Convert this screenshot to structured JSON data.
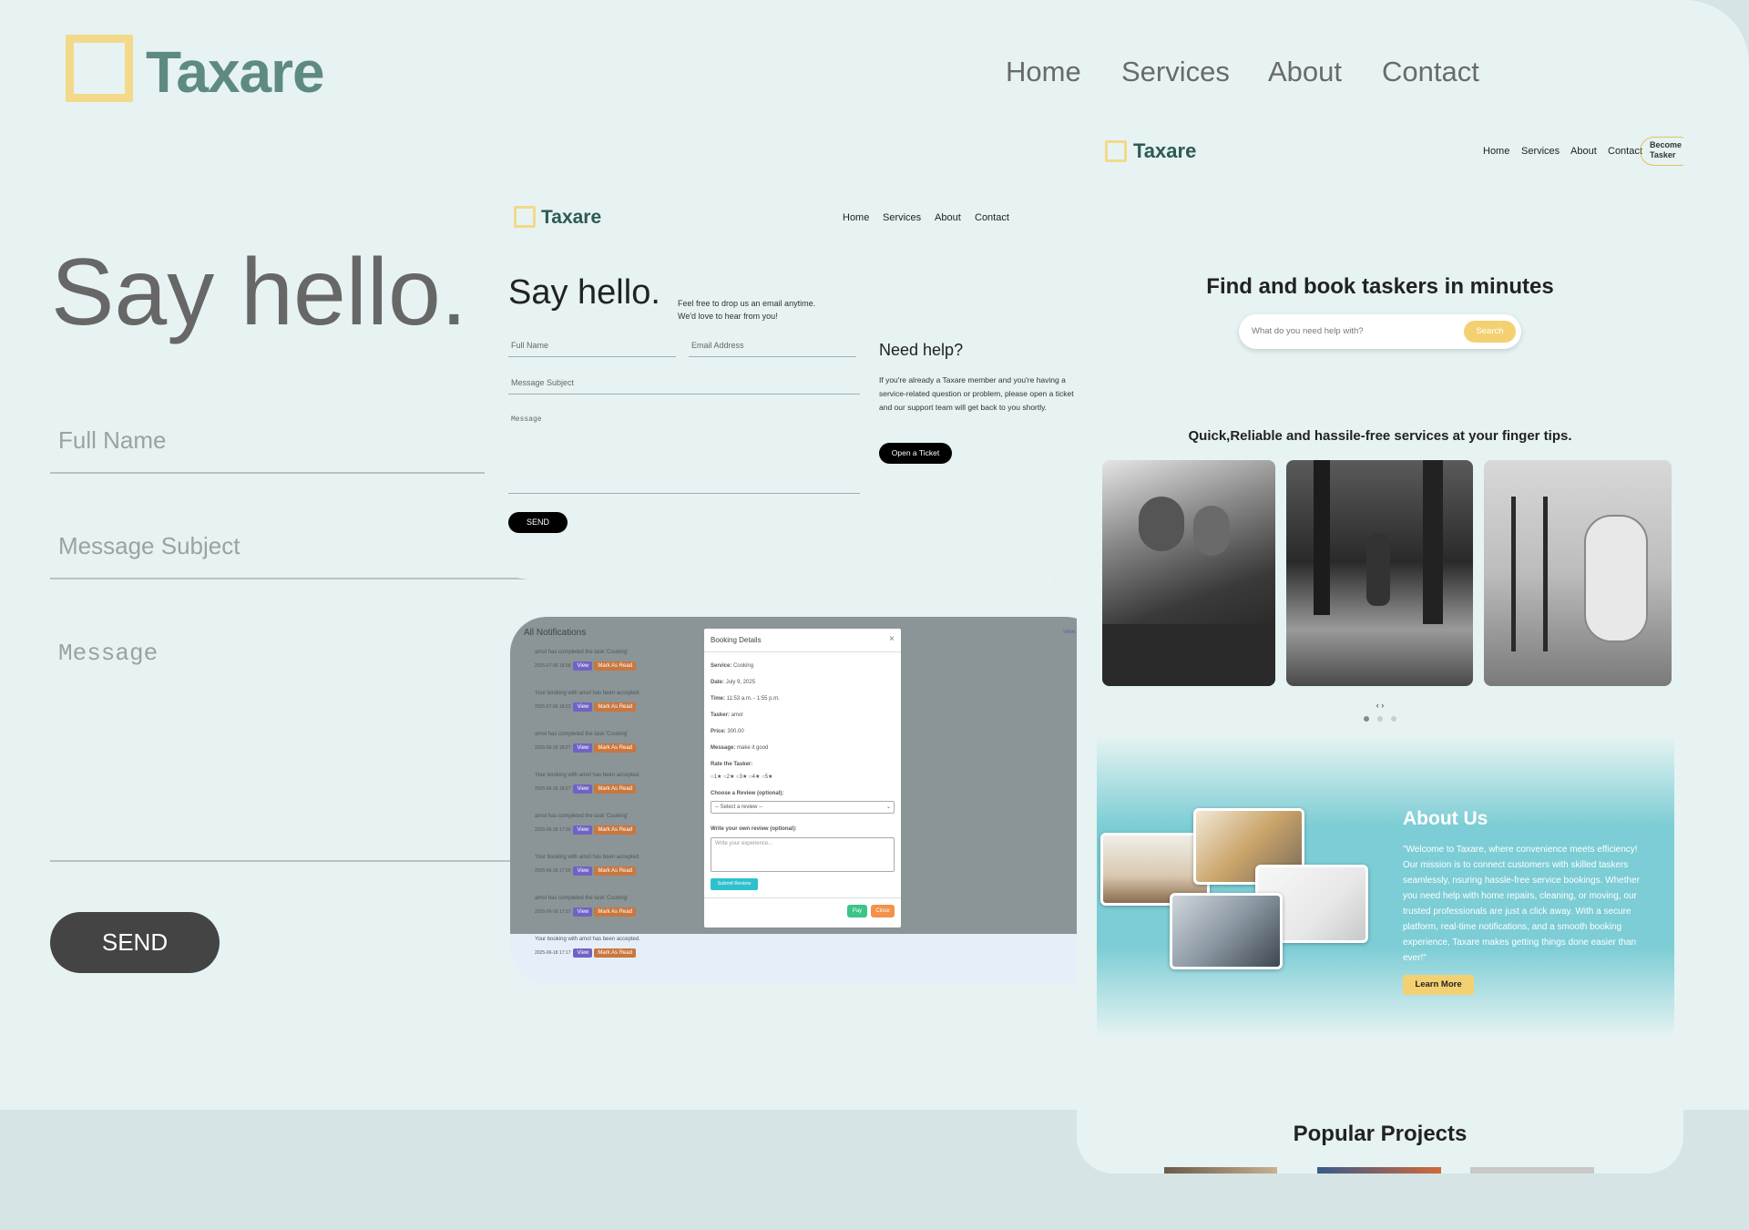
{
  "background_page": {
    "brand": "Taxare",
    "nav": [
      "Home",
      "Services",
      "About",
      "Contact"
    ],
    "heading": "Say hello.",
    "fields": {
      "full_name": "Full Name",
      "subject": "Message Subject",
      "message": "Message"
    },
    "send_label": "SEND"
  },
  "contact_mock": {
    "brand": "Taxare",
    "nav": [
      "Home",
      "Services",
      "About",
      "Contact"
    ],
    "heading": "Say hello.",
    "intro": "Feel free to drop us an email anytime. We'd love to hear from you!",
    "fields": {
      "full_name": "Full Name",
      "email": "Email Address",
      "subject": "Message Subject",
      "message": "Message"
    },
    "send_label": "SEND",
    "help_title": "Need help?",
    "help_text": "If you're already a Taxare member and you're having a service-related question or problem, please open a ticket and our support team will get back to you shortly.",
    "ticket_label": "Open a Ticket"
  },
  "notifications_mock": {
    "title": "All Notifications",
    "view_all": "View All",
    "items": [
      {
        "text": "amol has completed the task 'Cooking'",
        "time": "2025-07-06 18:38"
      },
      {
        "text": "Your booking with amol has been accepted.",
        "time": "2025-07-06 18:23"
      },
      {
        "text": "amol has completed the task 'Cooking'",
        "time": "2025-06-18 18:27"
      },
      {
        "text": "Your booking with amol has been accepted.",
        "time": "2025-06-18 18:27"
      },
      {
        "text": "amol has completed the task 'Cooking'",
        "time": "2025-06-18 17:30"
      },
      {
        "text": "Your booking with amol has been accepted.",
        "time": "2025-06-18 17:26"
      },
      {
        "text": "amol has completed the task 'Cooking'",
        "time": "2025-06-18 17:27"
      },
      {
        "text": "Your booking with amol has been accepted.",
        "time": "2025-06-18 17:17"
      }
    ],
    "view_label": "View",
    "mark_label": "Mark As Read",
    "modal": {
      "title": "Booking Details",
      "close_x": "×",
      "service_k": "Service:",
      "service_v": "Cooking",
      "date_k": "Date:",
      "date_v": "July 9, 2025",
      "time_k": "Time:",
      "time_v": "11:53 a.m. - 1:55 p.m.",
      "tasker_k": "Tasker:",
      "tasker_v": "amol",
      "price_k": "Price:",
      "price_v": "300.00",
      "message_k": "Message:",
      "message_v": "make it good",
      "rate_label": "Rate the Tasker:",
      "ratings": [
        "1★",
        "2★",
        "3★",
        "4★",
        "5★"
      ],
      "choose_label": "Choose a Review (optional):",
      "select_value": "-- Select a review --",
      "write_label": "Write your own review (optional):",
      "textarea_placeholder": "Write your experience...",
      "submit_label": "Submit Review",
      "pay_label": "Pay",
      "close_label": "Close"
    }
  },
  "home_mock": {
    "brand": "Taxare",
    "nav": [
      "Home",
      "Services",
      "About",
      "Contact"
    ],
    "become_label": "Become Tasker",
    "hero_title": "Find and book taskers in minutes",
    "search_placeholder": "What do you need help with?",
    "search_label": "Search",
    "tagline": "Quick,Reliable and hassile-free services at your finger tips.",
    "carousel_arrows": "‹ ›",
    "about_title": "About Us",
    "about_text": "\"Welcome to Taxare, where convenience meets efficiency! Our mission is to connect customers with skilled taskers seamlessly, nsuring hassle-free service bookings. Whether you need help with home repairs, cleaning, or moving, our trusted professionals are just a click away. With a secure platform, real-time notifications, and a smooth booking experience, Taxare makes getting things done easier than ever!\"",
    "learn_label": "Learn More",
    "popular_title": "Popular Projects"
  },
  "colors": {
    "accent": "#f3d98a",
    "brand_text": "#2f5a52",
    "bg": "#e6f3f2",
    "teal": "#7ccdd5",
    "purple": "#7b6cd9",
    "orange": "#f2924b",
    "green": "#3cc48a"
  }
}
